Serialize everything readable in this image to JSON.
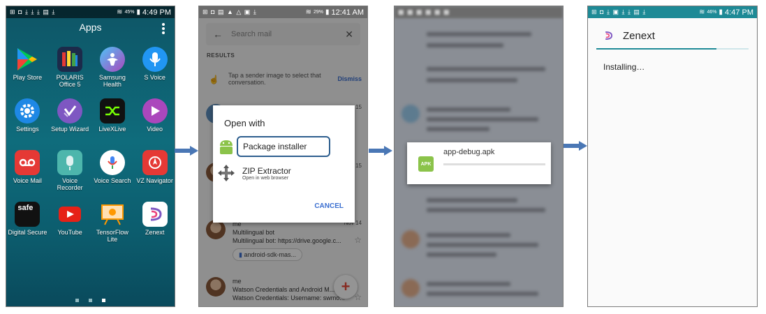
{
  "panel1": {
    "status": {
      "icons": "⊞ ◘ ⤓ ⤓ ⤓ ▤ ⤓",
      "battery": "45%",
      "time": "4:49 PM"
    },
    "title": "Apps",
    "apps": [
      {
        "label": "Play Store",
        "icon": "play-store-icon",
        "color": "#ffffff"
      },
      {
        "label": "POLARIS Office 5",
        "icon": "polaris-office-icon",
        "color": "#1c2a4a"
      },
      {
        "label": "Samsung Health",
        "icon": "samsung-health-icon",
        "color": "#6a5acd"
      },
      {
        "label": "S Voice",
        "icon": "s-voice-icon",
        "color": "#2196f3"
      },
      {
        "label": "Settings",
        "icon": "settings-icon",
        "color": "#1e88e5"
      },
      {
        "label": "Setup Wizard",
        "icon": "setup-wizard-icon",
        "color": "#7e57c2"
      },
      {
        "label": "LiveXLive",
        "icon": "livexlive-icon",
        "color": "#111111"
      },
      {
        "label": "Video",
        "icon": "video-icon",
        "color": "#9c27b0"
      },
      {
        "label": "Voice Mail",
        "icon": "voice-mail-icon",
        "color": "#e53935"
      },
      {
        "label": "Voice Recorder",
        "icon": "voice-recorder-icon",
        "color": "#26a69a"
      },
      {
        "label": "Voice Search",
        "icon": "voice-search-icon",
        "color": "#ffffff"
      },
      {
        "label": "VZ Navigator",
        "icon": "vz-navigator-icon",
        "color": "#e53935"
      },
      {
        "label": "Digital Secure",
        "icon": "digital-secure-icon",
        "color": "#111111",
        "text": "safe"
      },
      {
        "label": "YouTube",
        "icon": "youtube-icon",
        "color": "#ffffff"
      },
      {
        "label": "TensorFlow Lite",
        "icon": "tensorflow-lite-icon",
        "color": "#ffffff"
      },
      {
        "label": "Zenext",
        "icon": "zenext-icon",
        "color": "#ffffff"
      }
    ]
  },
  "panel2": {
    "status": {
      "battery": "29%",
      "time": "12:41 AM"
    },
    "search_placeholder": "Search mail",
    "results_label": "RESULTS",
    "tip_text": "Tap a sender image to select that conversation.",
    "dismiss_label": "Dismiss",
    "dialog": {
      "title": "Open with",
      "options": [
        {
          "label": "Package installer",
          "sub": ""
        },
        {
          "label": "ZIP Extractor",
          "sub": "Open in web browser"
        }
      ],
      "cancel_label": "CANCEL"
    },
    "mails": [
      {
        "sender": "me",
        "subject": "Multilingual bot",
        "preview": "Multilingual bot:  https://drive.google.c...",
        "date": "Nov 14",
        "attachment": "android-sdk-mas..."
      },
      {
        "sender": "me",
        "subject": "Watson Credentials and Android M...",
        "preview": "Watson Credentials: Username: swmo..."
      }
    ],
    "peek_dates": [
      "15",
      "15"
    ]
  },
  "panel3": {
    "file_name": "app-debug.apk",
    "apk_badge": "APK",
    "progress": 0
  },
  "panel4": {
    "status": {
      "battery": "46%",
      "time": "4:47 PM"
    },
    "app_name": "Zenext",
    "status_text": "Installing…",
    "progress": 0.79,
    "accent": "#1e8a96"
  }
}
